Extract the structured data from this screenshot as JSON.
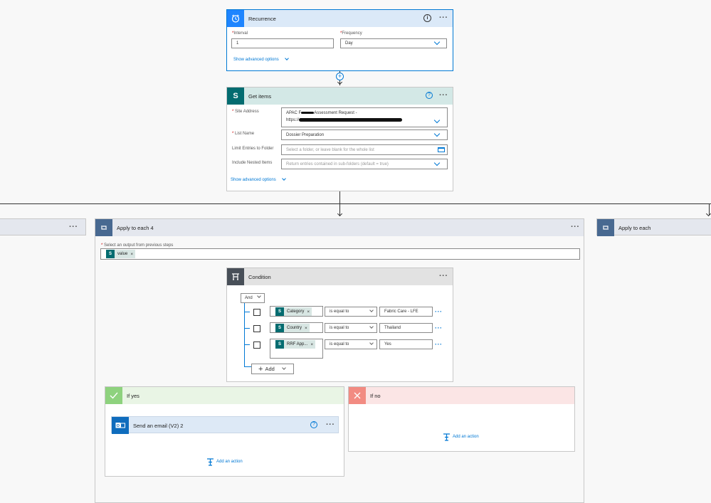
{
  "recurrence": {
    "title": "Recurrence",
    "interval_label": "Interval",
    "interval_value": "1",
    "frequency_label": "Frequency",
    "frequency_value": "Day",
    "advanced": "Show advanced options",
    "info_icon": "info-icon",
    "color": "#0078d4"
  },
  "get_items": {
    "title": "Get items",
    "site_label": "Site Address",
    "site_value_line1": "APAC F",
    "site_value_line1b": "Assessment Request -",
    "site_value_line2": "https://",
    "list_label": "List Name",
    "list_value": "Dossier Preparation",
    "limit_label": "Limit Entries to Folder",
    "limit_placeholder": "Select a folder, or leave blank for the whole list",
    "nested_label": "Include Nested Items",
    "nested_placeholder": "Return entries contained in sub-folders (default = true)",
    "advanced": "Show advanced options",
    "color": "#036c70"
  },
  "apply_each_4": {
    "title": "Apply to each 4",
    "select_label": "Select an output from previous steps",
    "token": "value"
  },
  "apply_each_right": {
    "title": "Apply to each"
  },
  "condition": {
    "title": "Condition",
    "operator": "And",
    "rows": [
      {
        "token": "Category",
        "op": "is equal to",
        "value": "Fabric Care - LFE"
      },
      {
        "token": "Country",
        "op": "is equal to",
        "value": "Thailand"
      },
      {
        "token": "RRF App...",
        "op": "is equal to",
        "value": "Yes"
      }
    ],
    "add_label": "Add"
  },
  "if_yes": {
    "title": "If yes",
    "action_title": "Send an email (V2) 2",
    "add_action": "Add an action",
    "color": "#5cb85c"
  },
  "if_no": {
    "title": "If no",
    "add_action": "Add an action",
    "color": "#f28b82"
  }
}
